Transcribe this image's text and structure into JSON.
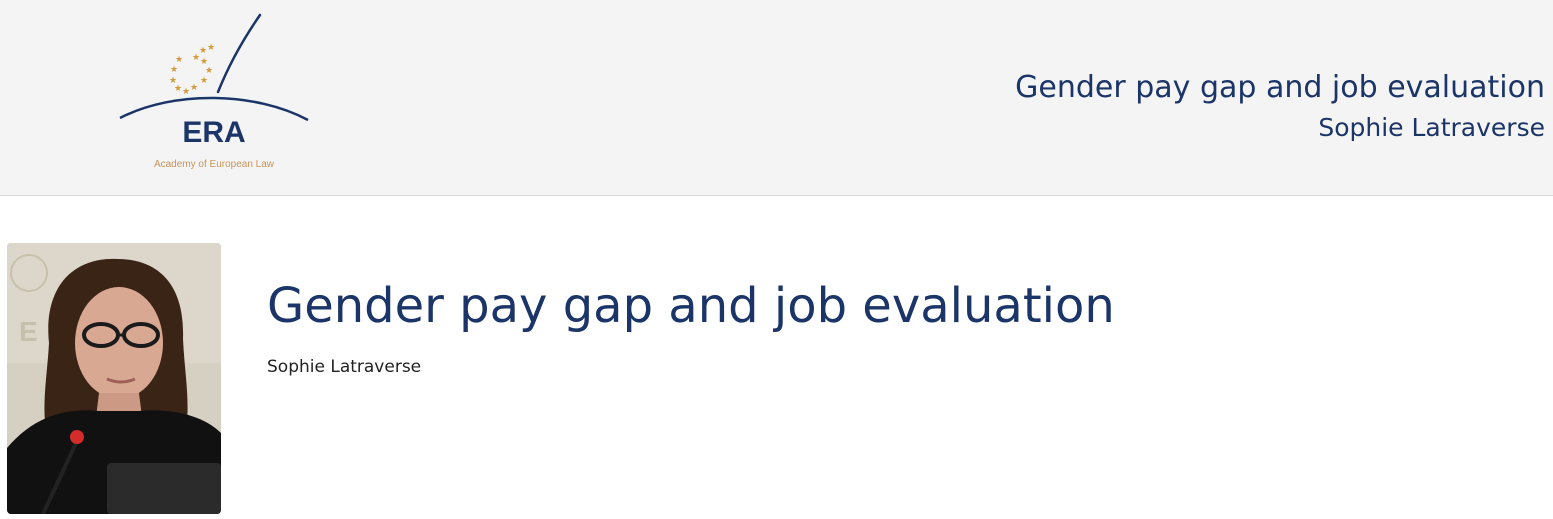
{
  "header": {
    "logo": {
      "acronym": "ERA",
      "tagline": "Academy of European Law",
      "icon": "era-logo-icon"
    },
    "title": "Gender pay gap and job evaluation",
    "subtitle": "Sophie Latraverse"
  },
  "main": {
    "photo_icon": "speaker-photo",
    "title": "Gender pay gap and job evaluation",
    "author": "Sophie Latraverse"
  },
  "colors": {
    "brand_blue": "#1b3568",
    "logo_gold": "#d49a3a",
    "header_bg": "#f4f4f4"
  }
}
